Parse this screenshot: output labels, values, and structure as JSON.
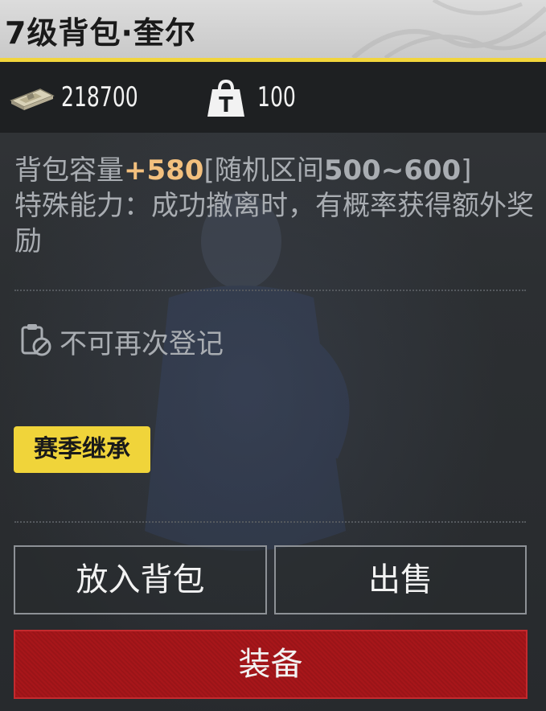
{
  "item": {
    "title": "7级背包·奎尔"
  },
  "currency": {
    "money_icon": "cash-stack-icon",
    "money_value": "218700",
    "weight_icon": "weight-t-icon",
    "weight_value": "100"
  },
  "description": {
    "capacity_label": "背包容量",
    "capacity_value": "+580",
    "range_open": "[随机区间",
    "range_value": "500~600",
    "range_close": "]",
    "ability_text": "特殊能力：成功撤离时，有概率获得额外奖励"
  },
  "register": {
    "icon": "clipboard-forbidden-icon",
    "text": "不可再次登记"
  },
  "badge": {
    "label": "赛季继承"
  },
  "actions": {
    "put_in_backpack": "放入背包",
    "sell": "出售",
    "equip": "装备"
  },
  "colors": {
    "accent_yellow": "#f0d43a",
    "highlight_orange": "#f3c07e",
    "equip_red": "#a7161a"
  }
}
